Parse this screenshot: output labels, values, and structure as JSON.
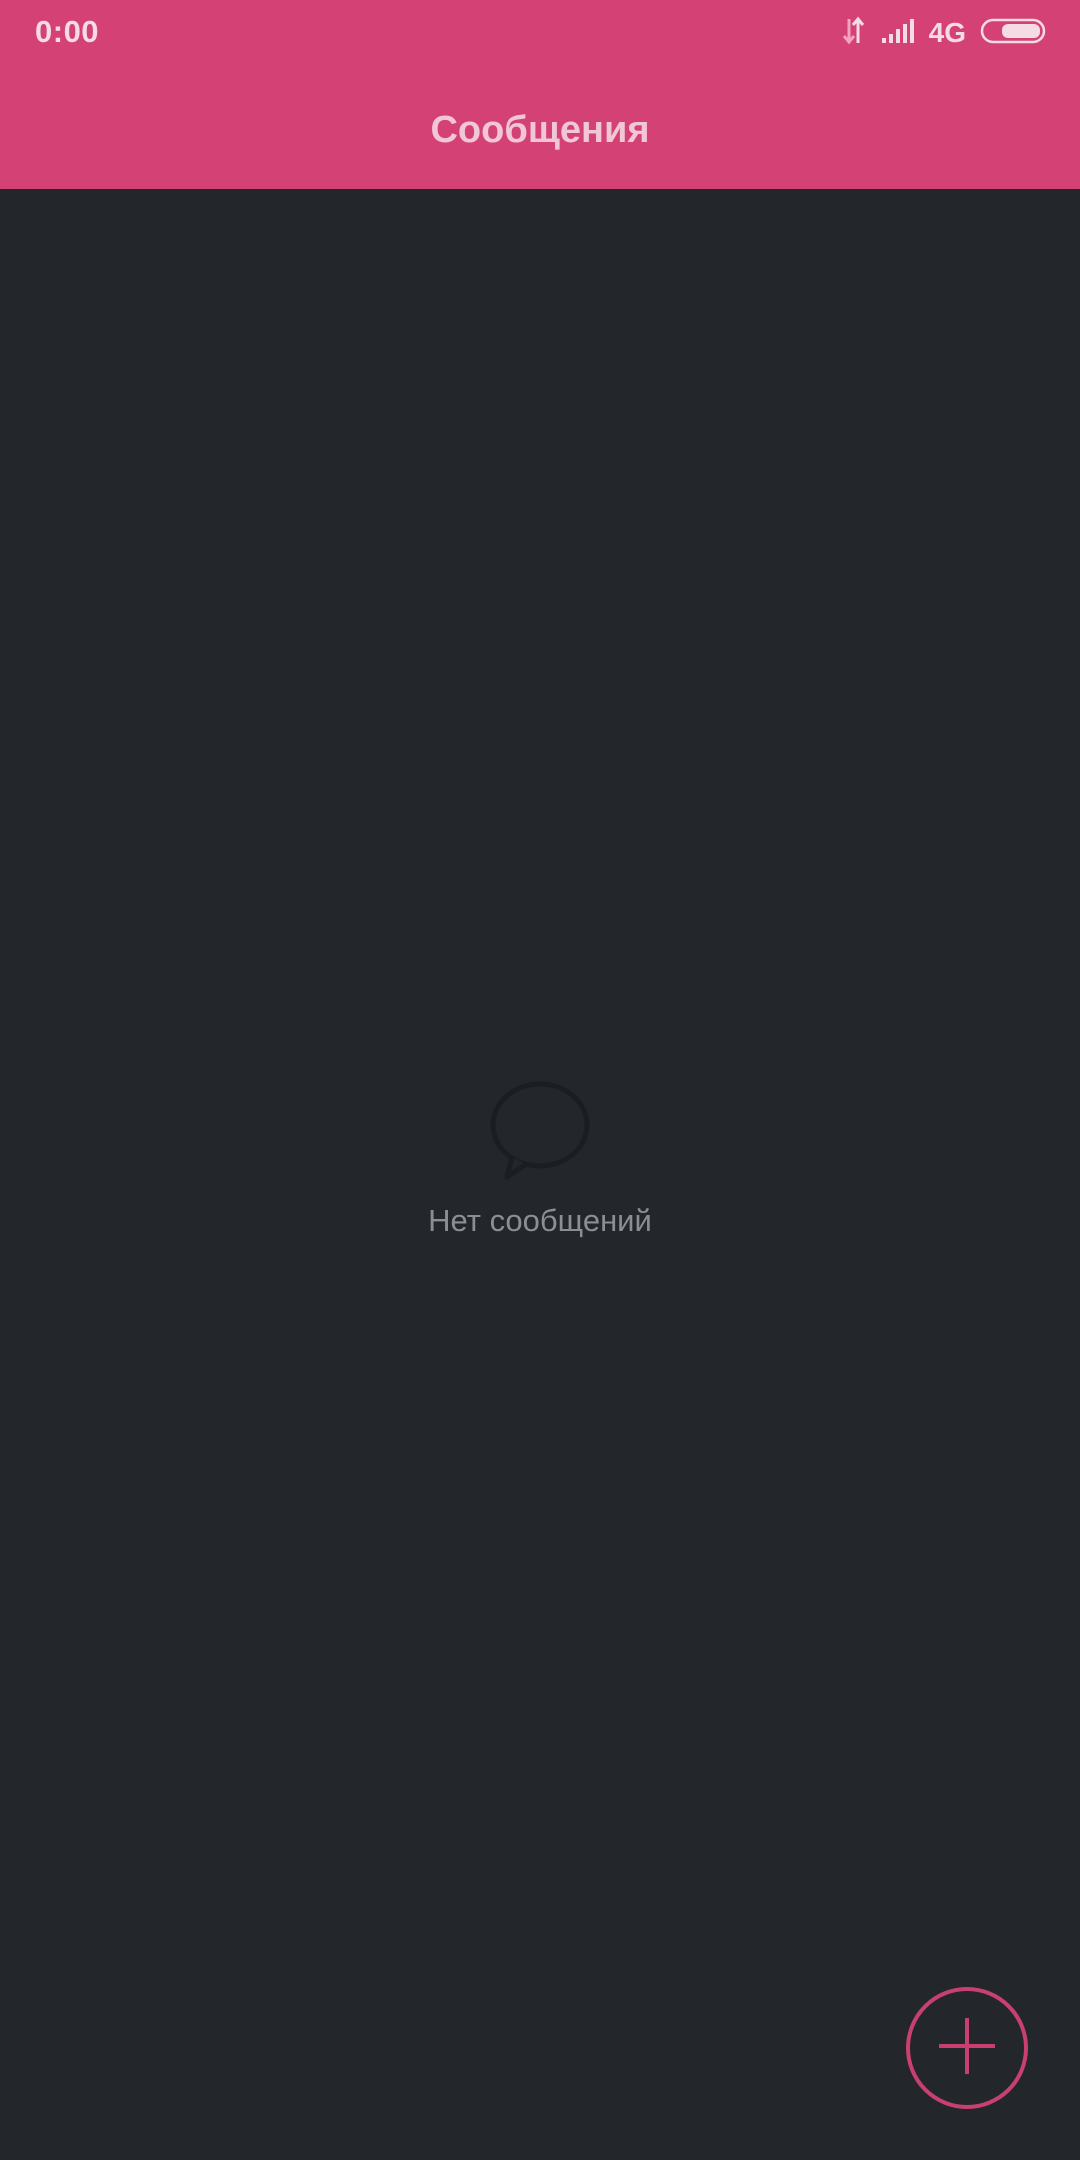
{
  "status_bar": {
    "time": "0:00",
    "network": "4G",
    "icons": [
      "data-transfer-icon",
      "signal-strength-icon",
      "battery-icon"
    ]
  },
  "header": {
    "title": "Сообщения"
  },
  "empty_state": {
    "icon": "chat-bubble-icon",
    "text": "Нет сообщений"
  },
  "fab": {
    "icon": "plus-icon"
  },
  "colors": {
    "accent": "#d44175",
    "background": "#23262b",
    "title_text": "#f1c6d5",
    "muted_text": "#8c8e93"
  }
}
